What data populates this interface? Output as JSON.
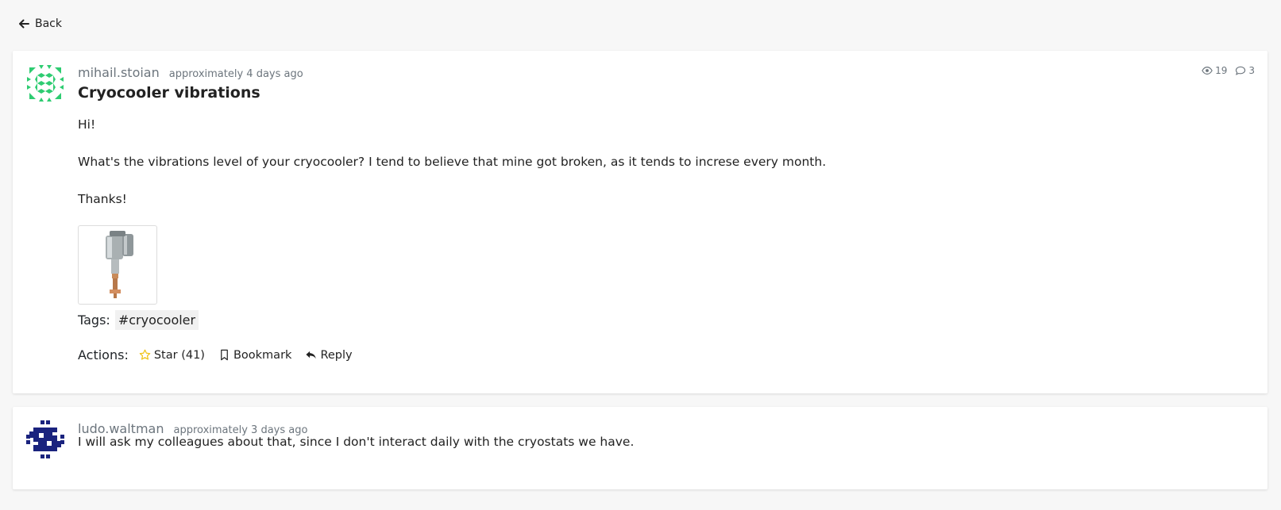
{
  "nav": {
    "back_label": "Back"
  },
  "post": {
    "author": "mihail.stoian",
    "time": "approximately 4 days ago",
    "views": "19",
    "comments": "3",
    "title": "Cryocooler vibrations",
    "paragraphs": [
      "Hi!",
      "What's the vibrations level of your cryocooler? I tend to believe that mine got broken, as it tends to increse every month.",
      "Thanks!"
    ],
    "tags_label": "Tags:",
    "tags": [
      "#cryocooler"
    ],
    "actions_label": "Actions:",
    "actions": {
      "star": "Star (41)",
      "bookmark": "Bookmark",
      "reply": "Reply"
    },
    "avatar_color": "#2ecc71"
  },
  "reply": {
    "author": "ludo.waltman",
    "time": "approximately 3 days ago",
    "text": "I will ask my colleagues about that, since I don't interact daily with the cryostats we have.",
    "avatar_color": "#1a237e"
  },
  "colors": {
    "star": "#f0c419",
    "muted": "#6c757d",
    "background": "#f7f7f7"
  },
  "icons": {
    "back": "arrow-left-icon",
    "views": "eye-icon",
    "comments": "comment-icon",
    "star": "star-icon",
    "bookmark": "bookmark-icon",
    "reply": "reply-icon"
  }
}
